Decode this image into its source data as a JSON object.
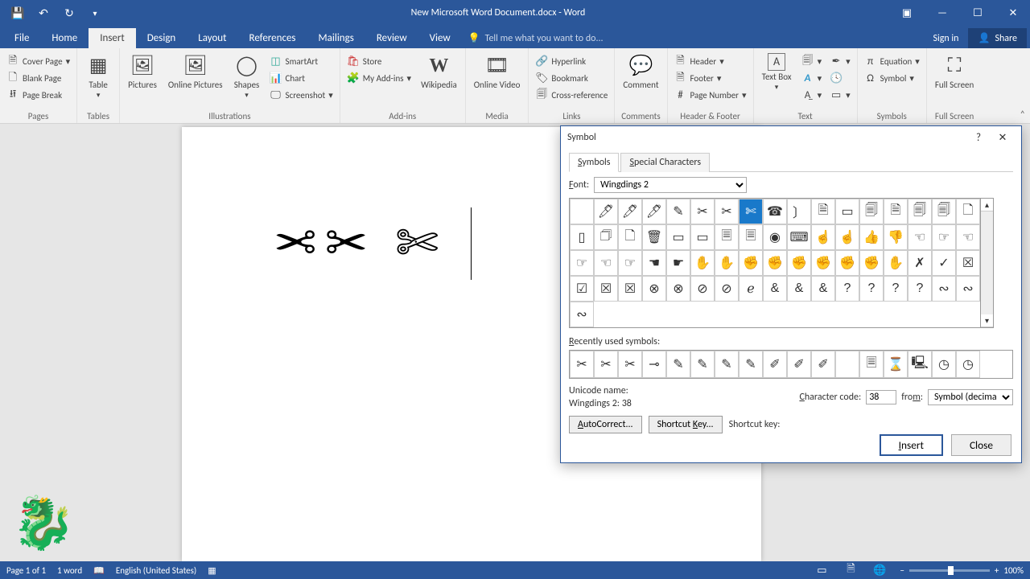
{
  "titlebar": {
    "doc_title": "New Microsoft Word Document.docx - Word"
  },
  "tabs": {
    "file": "File",
    "home": "Home",
    "insert": "Insert",
    "design": "Design",
    "layout": "Layout",
    "references": "References",
    "mailings": "Mailings",
    "review": "Review",
    "view": "View",
    "tellme": "Tell me what you want to do...",
    "signin": "Sign in",
    "share": "Share"
  },
  "ribbon": {
    "pages": {
      "cover": "Cover Page",
      "blank": "Blank Page",
      "break": "Page Break",
      "label": "Pages"
    },
    "tables": {
      "table": "Table",
      "label": "Tables"
    },
    "illus": {
      "pictures": "Pictures",
      "online": "Online Pictures",
      "shapes": "Shapes",
      "smartart": "SmartArt",
      "chart": "Chart",
      "screenshot": "Screenshot",
      "label": "Illustrations"
    },
    "addins": {
      "store": "Store",
      "myaddins": "My Add-ins",
      "wikipedia": "Wikipedia",
      "label": "Add-ins"
    },
    "media": {
      "video": "Online Video",
      "label": "Media"
    },
    "links": {
      "hyperlink": "Hyperlink",
      "bookmark": "Bookmark",
      "crossref": "Cross-reference",
      "label": "Links"
    },
    "comments": {
      "comment": "Comment",
      "label": "Comments"
    },
    "hf": {
      "header": "Header",
      "footer": "Footer",
      "pagenum": "Page Number",
      "label": "Header & Footer"
    },
    "text": {
      "textbox": "Text Box",
      "label": "Text"
    },
    "symbols": {
      "equation": "Equation",
      "symbol": "Symbol",
      "label": "Symbols"
    },
    "fullscreen": {
      "btn": "Full Screen",
      "label": "Full Screen"
    }
  },
  "doc": {
    "glyphs": [
      "✂",
      "✂",
      "✄"
    ]
  },
  "dialog": {
    "title": "Symbol",
    "tab_symbols": "Symbols",
    "tab_special": "Special Characters",
    "font_label": "Font:",
    "font_value": "Wingdings 2",
    "recent_label": "Recently used symbols:",
    "unicode_label": "Unicode name:",
    "unicode_value": "Wingdings 2: 38",
    "charcode_label": "Character code:",
    "charcode_value": "38",
    "from_label": "from:",
    "from_value": "Symbol (decimal)",
    "autocorrect": "AutoCorrect...",
    "shortcutkey_btn": "Shortcut Key...",
    "shortcutkey_label": "Shortcut key:",
    "insert": "Insert",
    "close": "Close",
    "grid": [
      [
        " ",
        "🖊",
        "🖊",
        "🖊",
        "✎",
        "✂",
        "✂",
        "✄",
        "☎",
        "〕",
        "🗎",
        "▭",
        "🗐",
        "🗎",
        "🗐",
        "🗐",
        "🗋",
        "▯"
      ],
      [
        "🗇",
        "🗋",
        "🗑",
        "▭",
        "▭",
        "🗏",
        "🗏",
        "◉",
        "⌨",
        "☝",
        "☝",
        "👍",
        "👎",
        "☜",
        "☞",
        "☜",
        "☞"
      ],
      [
        "☜",
        "☞",
        "☚",
        "☛",
        "✋",
        "✋",
        "✊",
        "✊",
        "✊",
        "✊",
        "✊",
        "✊",
        "✋",
        "✗",
        "✓",
        "☒",
        "☑"
      ],
      [
        "☒",
        "☒",
        "⊗",
        "⊗",
        "⊘",
        "⊘",
        "ℯ",
        "&",
        "&",
        "&",
        "?",
        "?",
        "?",
        "?",
        "∾",
        "∾",
        "∾"
      ]
    ],
    "selected": {
      "row": 0,
      "col": 7
    },
    "recent": [
      "✂",
      "✂",
      "✂",
      "⊸",
      "✎",
      "✎",
      "✎",
      "✎",
      "✐",
      "✐",
      "✐",
      " ",
      "🗏",
      "⌛",
      "🖳",
      "◷",
      "◷"
    ]
  },
  "status": {
    "page": "Page 1 of 1",
    "words": "1 word",
    "lang": "English (United States)",
    "zoom_minus": "−",
    "zoom_plus": "+",
    "zoom_value": "100%"
  }
}
